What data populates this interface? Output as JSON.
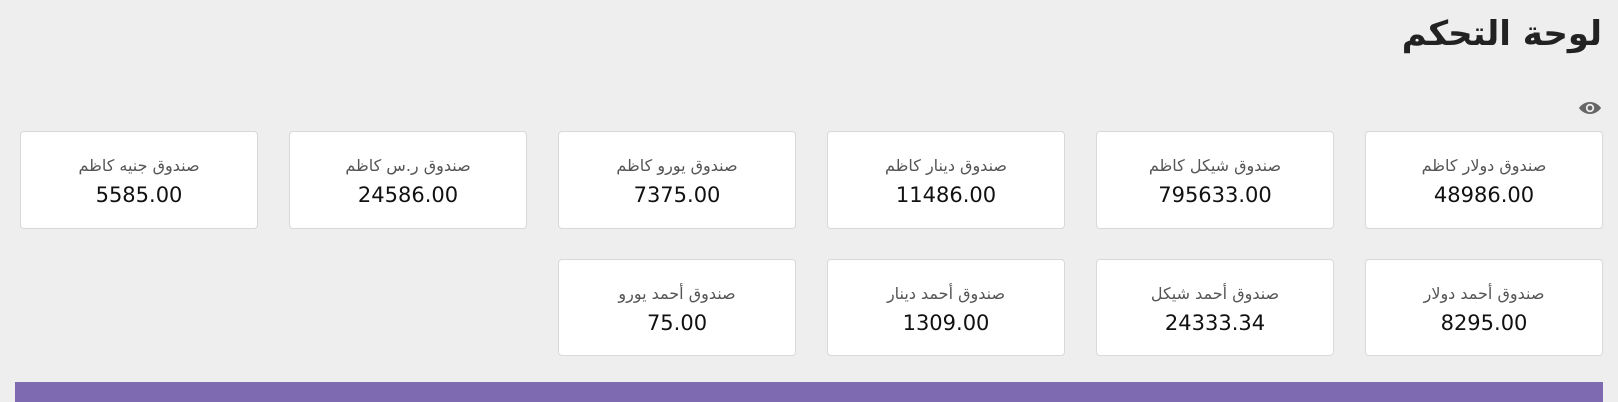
{
  "header": {
    "title": "لوحة التحكم",
    "toggle_icon": "eye-icon"
  },
  "boxes_row1": [
    {
      "label": "صندوق دولار كاظم",
      "value": "48986.00"
    },
    {
      "label": "صندوق شيكل كاظم",
      "value": "795633.00"
    },
    {
      "label": "صندوق دينار كاظم",
      "value": "11486.00"
    },
    {
      "label": "صندوق يورو كاظم",
      "value": "7375.00"
    },
    {
      "label": "صندوق ر.س كاظم",
      "value": "24586.00"
    },
    {
      "label": "صندوق جنيه كاظم",
      "value": "5585.00"
    }
  ],
  "boxes_row2": [
    {
      "label": "صندوق أحمد دولار",
      "value": "8295.00"
    },
    {
      "label": "صندوق أحمد شيكل",
      "value": "24333.34"
    },
    {
      "label": "صندوق أحمد دينار",
      "value": "1309.00"
    },
    {
      "label": "صندوق أحمد يورو",
      "value": "75.00"
    }
  ],
  "colors": {
    "background": "#eeeeee",
    "card": "#ffffff",
    "accent_bar": "#7e6ab0"
  }
}
